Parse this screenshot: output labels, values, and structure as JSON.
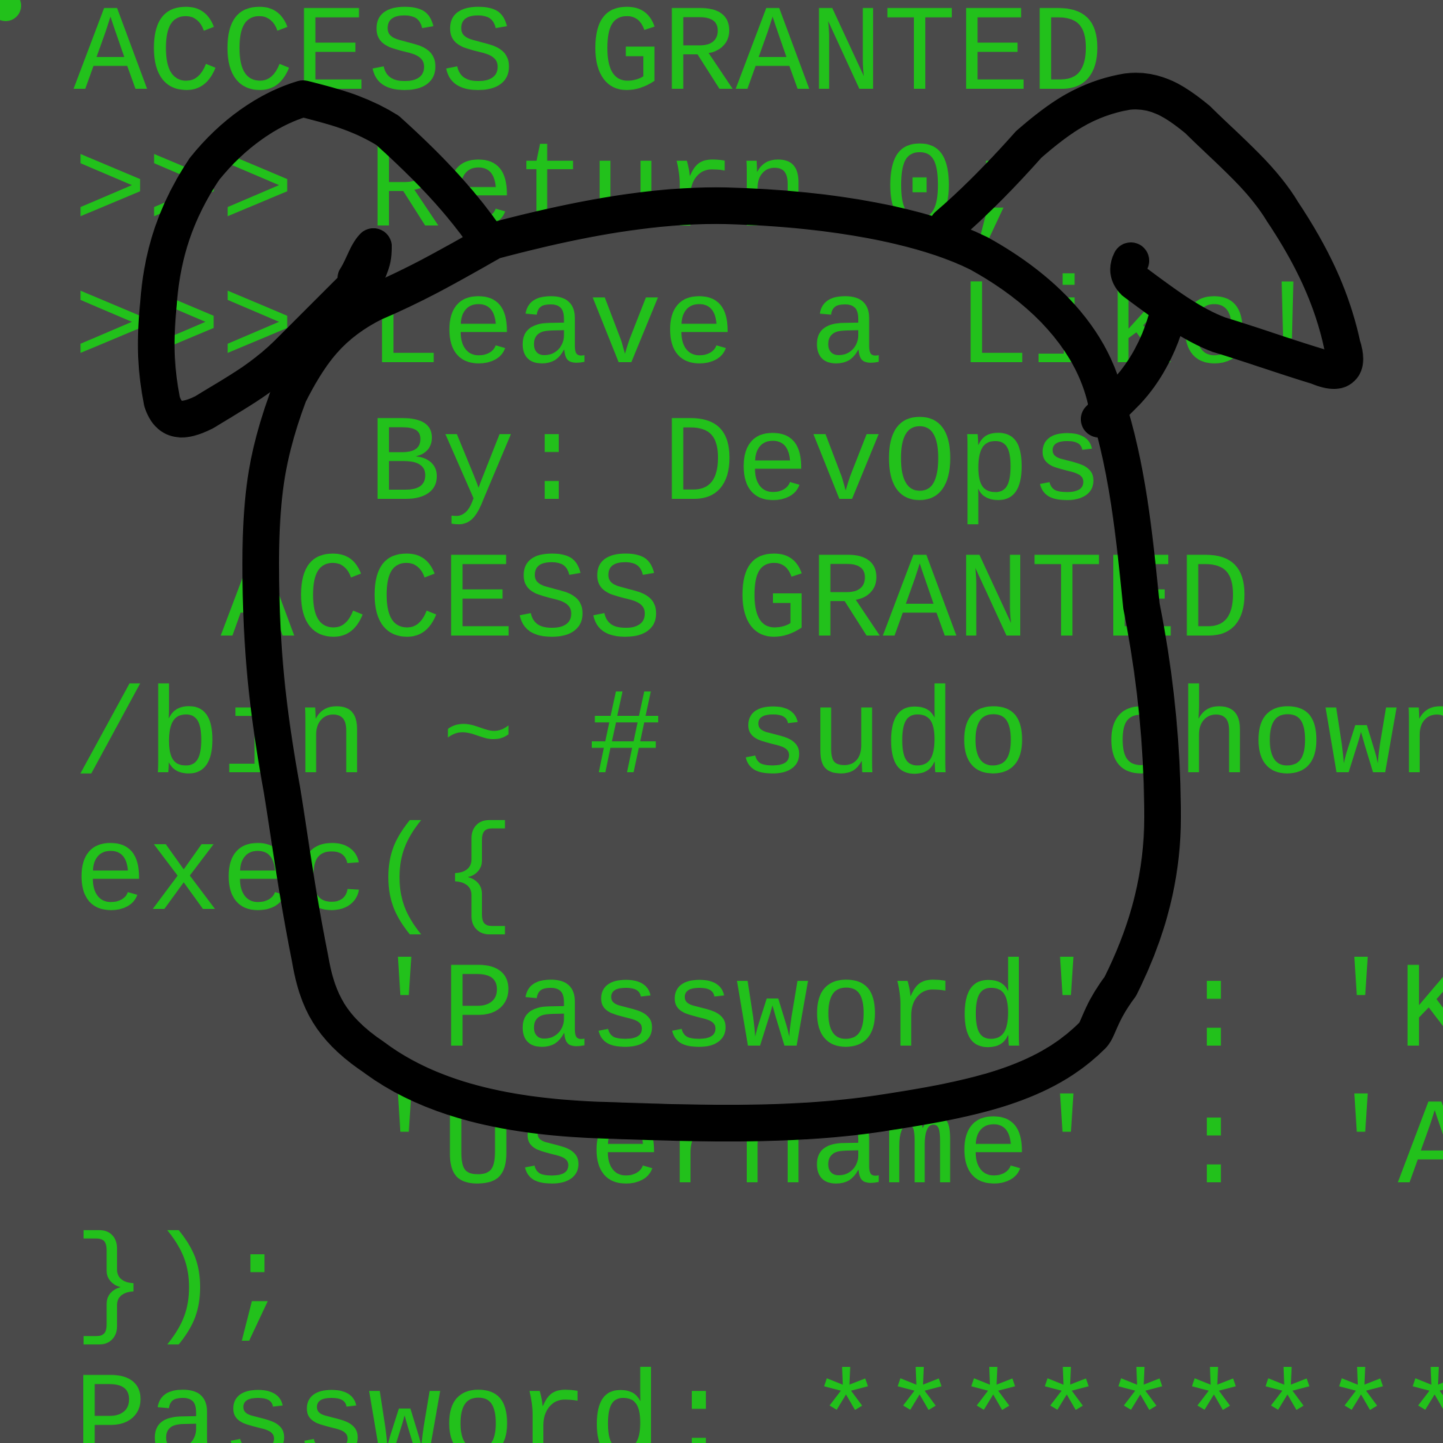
{
  "terminal": {
    "text_color": "#22c11b",
    "background_color": "#4a4a4a",
    "lines": [
      " ACCESS GRANTED",
      " >>> Return 0;",
      " >>> Leave a Like!",
      "     By: DevOps",
      "   ACCESS GRANTED",
      " /bin ~ # sudo chown",
      " exec({",
      "     'Password' : 'K",
      "     'Username' : 'A",
      " });",
      " Password: *********"
    ]
  },
  "overlay": {
    "description_icon": "dog-face-doodle-icon",
    "stroke_color": "#000000"
  }
}
